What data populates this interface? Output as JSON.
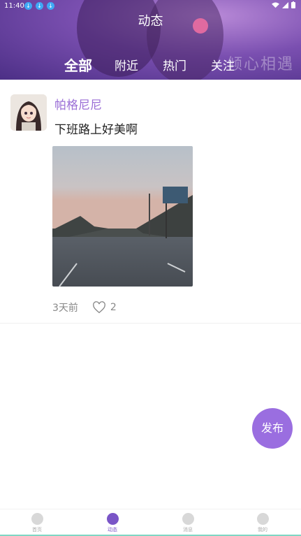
{
  "status_bar": {
    "time": "11:40",
    "app_dots": [
      "↓",
      "↓",
      "↓"
    ]
  },
  "header": {
    "title": "动态",
    "tabs": [
      {
        "label": "全部",
        "active": true
      },
      {
        "label": "附近",
        "active": false
      },
      {
        "label": "热门",
        "active": false
      },
      {
        "label": "关注",
        "active": false
      }
    ],
    "watermark": "倾心相遇"
  },
  "post": {
    "username": "帕格尼尼",
    "text": "下班路上好美啊",
    "time_ago": "3天前",
    "likes": "2"
  },
  "fab": {
    "label": "发布"
  },
  "bottom_nav": {
    "items": [
      {
        "label": "首页",
        "icon": "home-icon"
      },
      {
        "label": "动态",
        "icon": "moments-icon"
      },
      {
        "label": "消息",
        "icon": "message-icon"
      },
      {
        "label": "我的",
        "icon": "profile-icon"
      }
    ],
    "active_index": 1
  },
  "colors": {
    "accent": "#9a6ee0",
    "username": "#9b6fd6",
    "header_bg": "#6a45a3"
  }
}
